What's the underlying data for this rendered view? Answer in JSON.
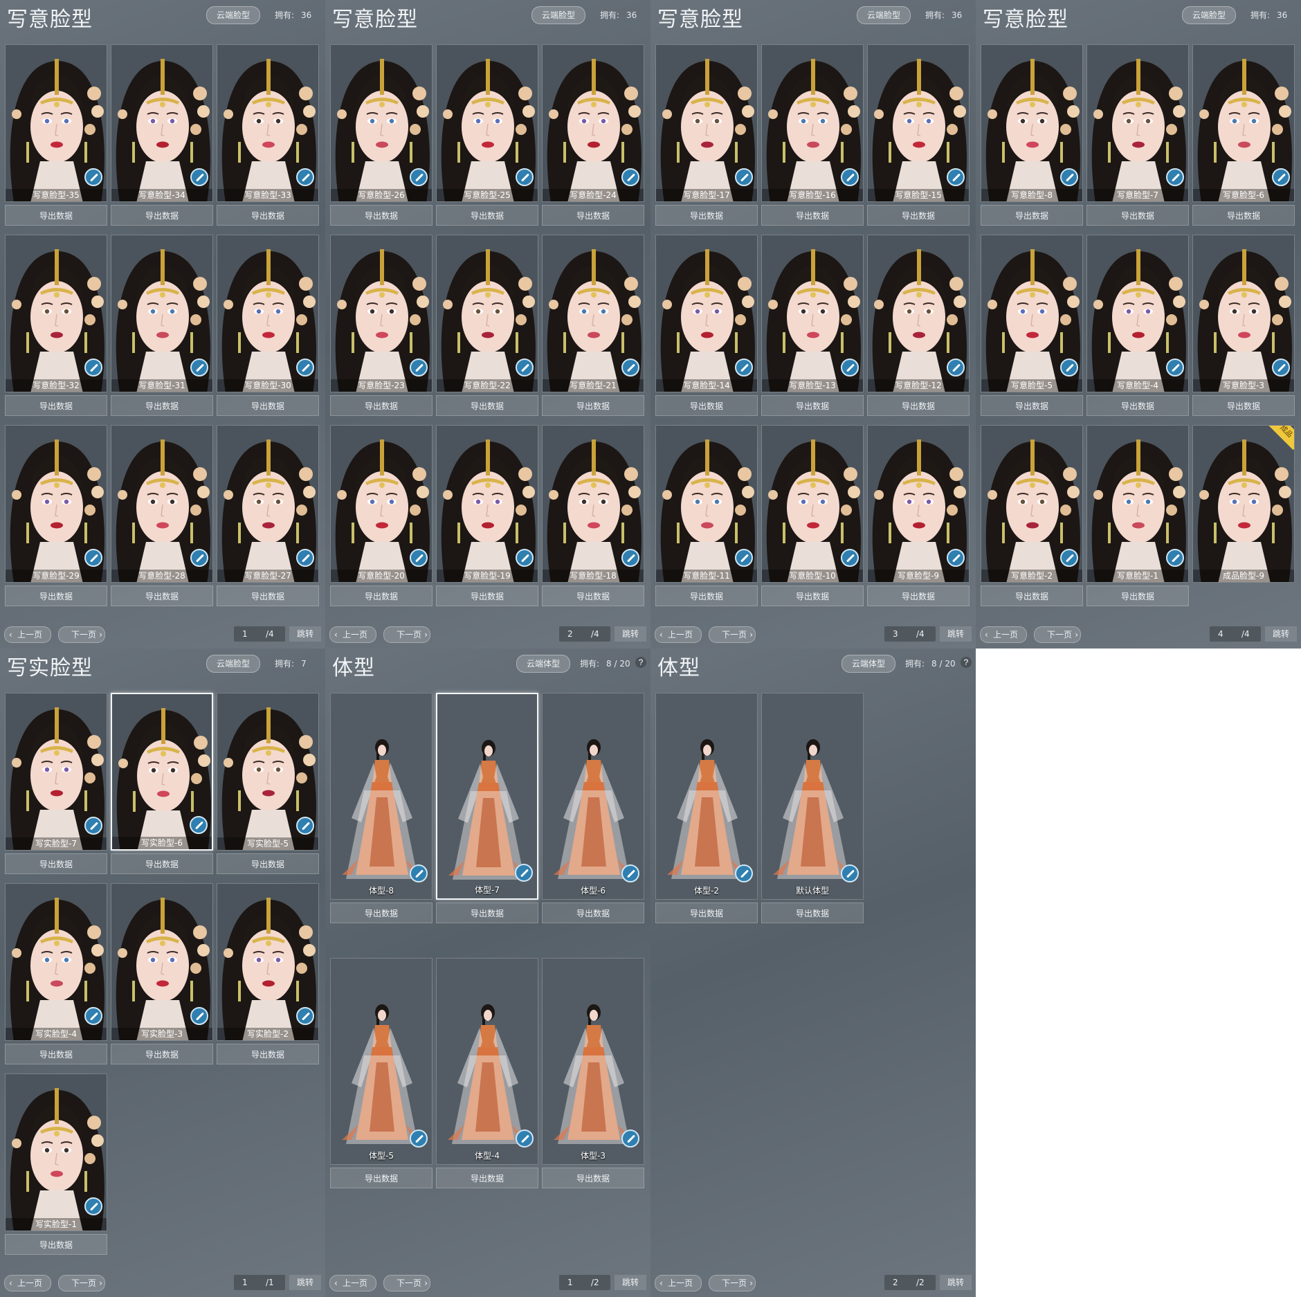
{
  "export_label": "导出数据",
  "prev_label": "上一页",
  "next_label": "下一页",
  "jump_label": "跳转",
  "owned_label": "拥有:",
  "panels": [
    {
      "title": "写意脸型",
      "cloud_btn": "云端脸型",
      "owned": "36",
      "page": "1",
      "total": "/4",
      "kind": "face",
      "items": [
        "写意脸型-35",
        "写意脸型-34",
        "写意脸型-33",
        "写意脸型-32",
        "写意脸型-31",
        "写意脸型-30",
        "写意脸型-29",
        "写意脸型-28",
        "写意脸型-27"
      ]
    },
    {
      "title": "写意脸型",
      "cloud_btn": "云端脸型",
      "owned": "36",
      "page": "2",
      "total": "/4",
      "kind": "face",
      "items": [
        "写意脸型-26",
        "写意脸型-25",
        "写意脸型-24",
        "写意脸型-23",
        "写意脸型-22",
        "写意脸型-21",
        "写意脸型-20",
        "写意脸型-19",
        "写意脸型-18"
      ]
    },
    {
      "title": "写意脸型",
      "cloud_btn": "云端脸型",
      "owned": "36",
      "page": "3",
      "total": "/4",
      "kind": "face",
      "items": [
        "写意脸型-17",
        "写意脸型-16",
        "写意脸型-15",
        "写意脸型-14",
        "写意脸型-13",
        "写意脸型-12",
        "写意脸型-11",
        "写意脸型-10",
        "写意脸型-9"
      ]
    },
    {
      "title": "写意脸型",
      "cloud_btn": "云端脸型",
      "owned": "36",
      "page": "4",
      "total": "/4",
      "kind": "face",
      "badge": "成品",
      "items": [
        "写意脸型-8",
        "写意脸型-7",
        "写意脸型-6",
        "写意脸型-5",
        "写意脸型-4",
        "写意脸型-3",
        "写意脸型-2",
        "写意脸型-1",
        "成品脸型-9"
      ]
    },
    {
      "title": "写实脸型",
      "cloud_btn": "云端脸型",
      "owned": "7",
      "page": "1",
      "total": "/1",
      "kind": "face",
      "items": [
        "写实脸型-7",
        "写实脸型-6",
        "写实脸型-5",
        "写实脸型-4",
        "写实脸型-3",
        "写实脸型-2",
        "写实脸型-1"
      ]
    },
    {
      "title": "体型",
      "cloud_btn": "云端体型",
      "owned": "8 / 20",
      "page": "1",
      "total": "/2",
      "kind": "body",
      "help": "?",
      "items": [
        "体型-8",
        "体型-7",
        "体型-6",
        "体型-5",
        "体型-4",
        "体型-3"
      ]
    },
    {
      "title": "体型",
      "cloud_btn": "云端体型",
      "owned": "8 / 20",
      "page": "2",
      "total": "/2",
      "kind": "body",
      "help": "?",
      "items": [
        "体型-2",
        "默认体型"
      ]
    }
  ]
}
